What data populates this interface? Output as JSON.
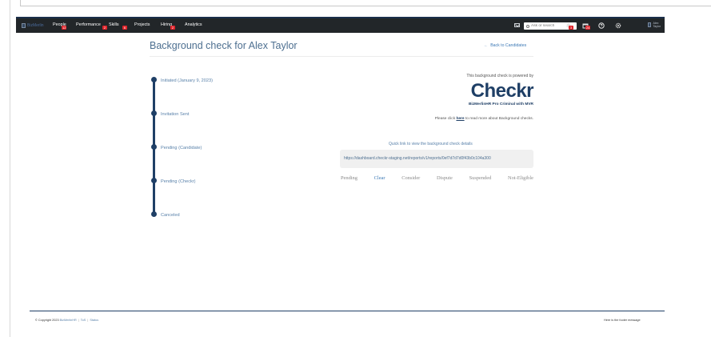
{
  "navbar": {
    "logo_alt": "BizMerlin",
    "items": [
      {
        "label": "People",
        "badge": "12"
      },
      {
        "label": "Performance",
        "badge": "2"
      },
      {
        "label": "Skills",
        "badge": "6"
      },
      {
        "label": "Projects",
        "badge": ""
      },
      {
        "label": "Hiring",
        "badge": "2"
      },
      {
        "label": "Analytics",
        "badge": ""
      }
    ],
    "search_placeholder": "Ask or search",
    "icons": [
      {
        "name": "mail-icon"
      },
      {
        "name": "notifications-icon",
        "badge": "3"
      },
      {
        "name": "calendar-icon",
        "badge": "24"
      },
      {
        "name": "help-icon"
      },
      {
        "name": "settings-icon"
      }
    ],
    "user_name": "Alex Taylor"
  },
  "page": {
    "title": "Background check for Alex Taylor",
    "back_label": "Back to Candidates"
  },
  "timeline": [
    {
      "label": "Initiated (January 9, 2023)"
    },
    {
      "label": "Invitation Sent"
    },
    {
      "label": "Pending (Candidate)"
    },
    {
      "label": "Pending (Checkr)"
    },
    {
      "label": "Canceled"
    }
  ],
  "checkr": {
    "powered_by": "This background check is powered by",
    "logo_text": "Checkr",
    "package": "BizMerlinHR Pro Criminal with MVR",
    "info_prefix": "Please click ",
    "info_link": "here",
    "info_suffix": " to read more about Background checks.",
    "quick_link": "Quick link to view the background check details",
    "report_url": "https://dashboard.checkr-staging.net/reports/v1/reports/0ef7d7d7d0f43b0c104a300",
    "statuses": [
      "Pending",
      "Clear",
      "Consider",
      "Dispute",
      "Suspended",
      "Not-Eligible"
    ],
    "active_status": "Clear"
  },
  "footer": {
    "copyright": "© Copyright 2023",
    "brand_link": "BizMerlinHR",
    "link_2": "ToS",
    "link_3": "Status",
    "message": "Here is the footer message"
  },
  "colors": {
    "navbar_bg": "#222629",
    "brand_navy": "#1f3f66",
    "link_blue": "#3b78b5",
    "badge_red": "#e0242b"
  }
}
